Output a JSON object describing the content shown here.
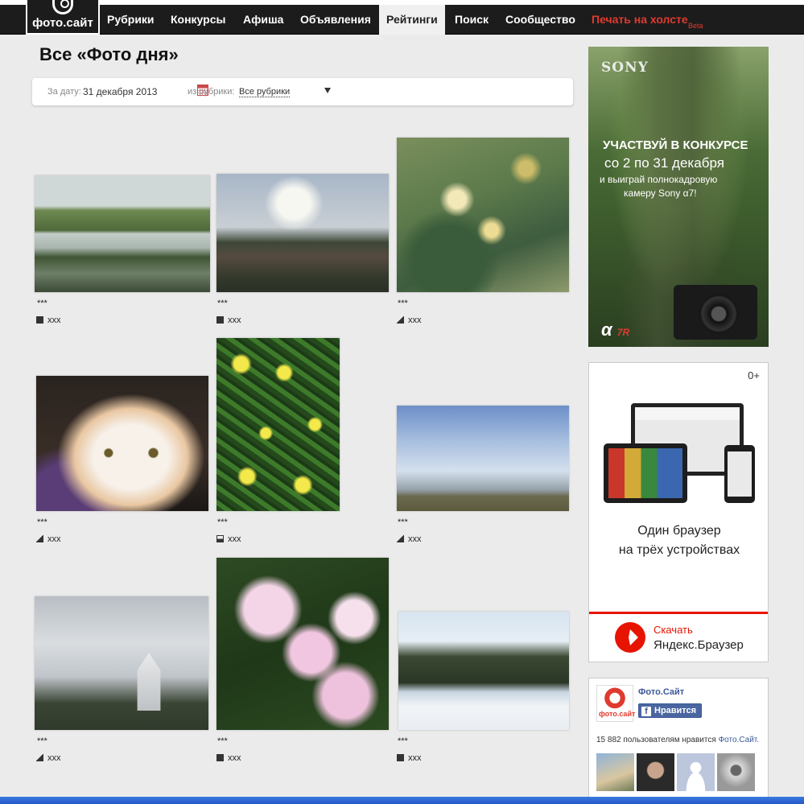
{
  "header": {
    "logo_text": "фото.сайт",
    "nav": [
      {
        "label": "Рубрики"
      },
      {
        "label": "Конкурсы"
      },
      {
        "label": "Афиша"
      },
      {
        "label": "Объявления"
      },
      {
        "label": "Рейтинги",
        "active": true
      },
      {
        "label": "Поиск"
      },
      {
        "label": "Сообщество"
      },
      {
        "label": "Печать на холсте",
        "highlight": "#e03a2f"
      }
    ],
    "beta_label": "Beta"
  },
  "page": {
    "title": "Все «Фото дня»"
  },
  "filter": {
    "date_label": "За дату:",
    "date_value": "31 декабря 2013",
    "category_label": "из рубрики:",
    "category_value": "Все рубрики"
  },
  "photos": [
    {
      "caption": "***",
      "author": "xxx",
      "icon": "square"
    },
    {
      "caption": "***",
      "author": "xxx",
      "icon": "square"
    },
    {
      "caption": "***",
      "author": "xxx",
      "icon": "stair"
    },
    {
      "caption": "***",
      "author": "xxx",
      "icon": "stair"
    },
    {
      "caption": "***",
      "author": "xxx",
      "icon": "half"
    },
    {
      "caption": "***",
      "author": "xxx",
      "icon": "stair"
    },
    {
      "caption": "***",
      "author": "xxx",
      "icon": "stair"
    },
    {
      "caption": "***",
      "author": "xxx",
      "icon": "square"
    },
    {
      "caption": "***",
      "author": "xxx",
      "icon": "square"
    }
  ],
  "ads": {
    "sony": {
      "brand": "SONY",
      "line1": "УЧАСТВУЙ В КОНКУРСЕ",
      "line2": "со 2 по 31 декабря",
      "line3": "и выиграй полнокадровую",
      "line4": "камеру Sony α7!",
      "model": "α",
      "model_suffix": "7R"
    },
    "yandex": {
      "age_rating": "0+",
      "message_line1": "Один браузер",
      "message_line2": "на трёх устройствах",
      "cta_line1": "Скачать",
      "cta_line2": "Яндекс.Браузер"
    }
  },
  "facebook": {
    "page_name": "Фото.Сайт",
    "logo_text": "фото.сайт",
    "like_label": "Нравится",
    "like_count_text": "15 882 пользователям нравится",
    "like_count_link": "Фото.Сайт."
  },
  "colors": {
    "nav_bg": "#1c1c1c",
    "accent_red": "#e03a2f",
    "facebook_blue": "#3b5998",
    "yandex_red": "#e61400",
    "page_bg": "#ebebeb"
  }
}
